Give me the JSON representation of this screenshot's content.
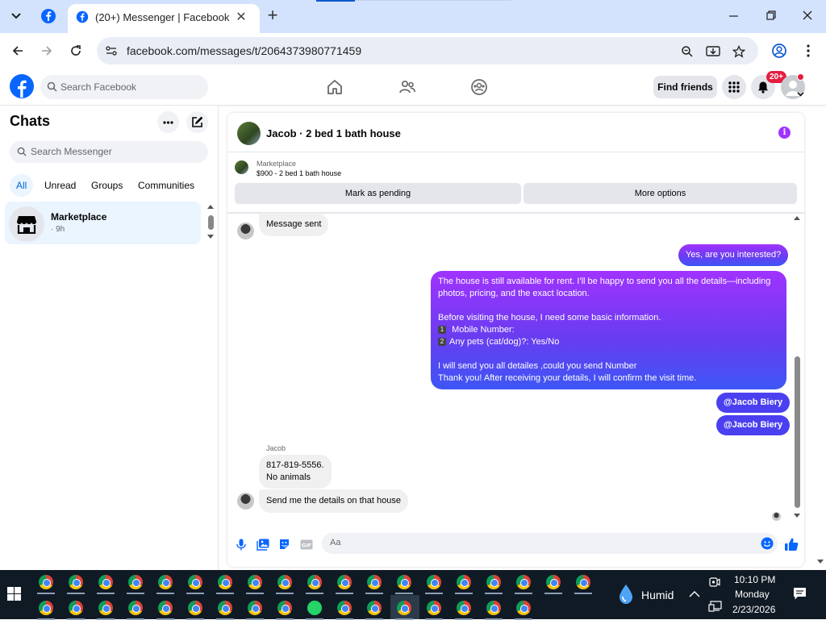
{
  "browser": {
    "tab_title": "(20+) Messenger | Facebook",
    "url": "facebook.com/messages/t/2064373980771459",
    "colors": {
      "tabbar_bg": "#d3e3fd",
      "omnibox_bg": "#e9eef6"
    }
  },
  "fb_header": {
    "search_placeholder": "Search Facebook",
    "find_friends_label": "Find friends",
    "notifications_badge": "20+",
    "brand_color": "#0866ff"
  },
  "sidebar": {
    "title": "Chats",
    "search_placeholder": "Search Messenger",
    "filters": [
      "All",
      "Unread",
      "Groups",
      "Communities"
    ],
    "active_filter": "All",
    "chats": [
      {
        "name": "Marketplace",
        "time": "· 9h"
      }
    ]
  },
  "conversation": {
    "title": "Jacob · 2 bed 1 bath house",
    "marketplace_label": "Marketplace",
    "listing": "$900 - 2 bed 1 bath house",
    "mark_pending_label": "Mark as pending",
    "more_options_label": "More options",
    "messages": {
      "msg1": "Message sent",
      "msg2": "Yes, are you interested?",
      "msg3_lines": [
        "The house is still available for rent. I'll be happy to send you all the details—including",
        "photos, pricing, and the exact location.",
        "",
        "Before visiting the house, I need some basic information.",
        "Mobile Number:",
        "Any pets (cat/dog)?: Yes/No",
        "",
        "I will send you all detailes ,could you send Number",
        "Thank you! After receiving your details, I will confirm the visit time."
      ],
      "msg3_num1": "1",
      "msg3_num2": "2",
      "mention1": "@Jacob Biery",
      "mention2": "@Jacob Biery",
      "sender_label": "Jacob",
      "msg4_line1": "817-819-5556.",
      "msg4_line2": "No animals",
      "msg5": "Send me the details on that house"
    },
    "composer_placeholder": "Aa",
    "accent_color": "#a033ff"
  },
  "taskbar": {
    "weather": "Humid",
    "time": "10:10 PM",
    "day": "Monday",
    "date": "2/23/2026"
  }
}
